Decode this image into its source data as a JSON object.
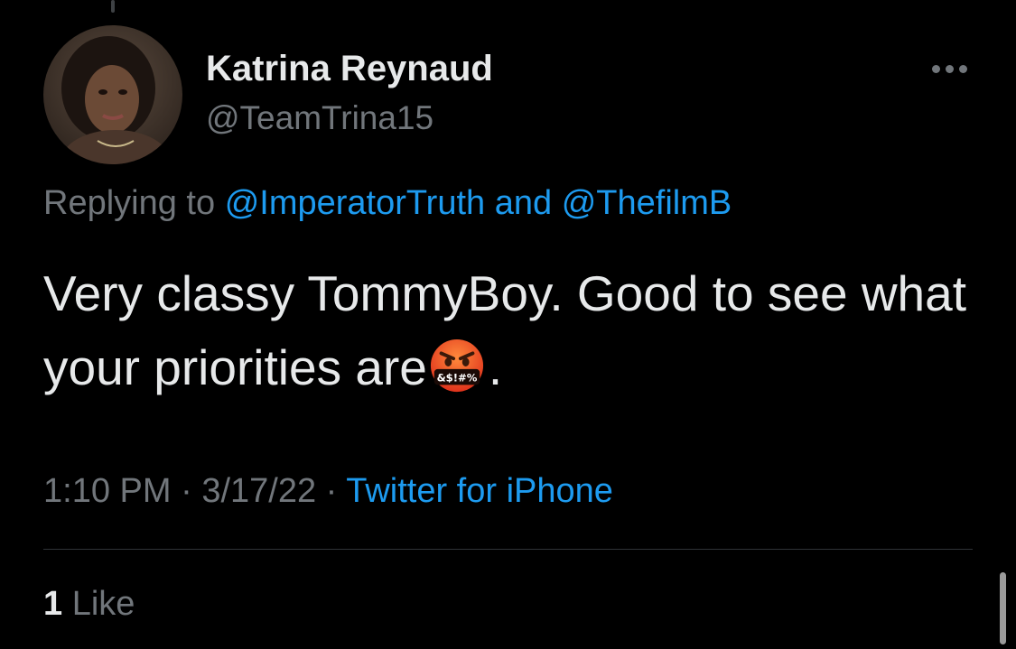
{
  "author": {
    "display_name": "Katrina Reynaud",
    "handle": "@TeamTrina15",
    "avatar_icon": "profile-photo"
  },
  "reply": {
    "prefix": "Replying to",
    "mention_1": "@ImperatorTruth",
    "conjunction": "and",
    "mention_2": "@ThefilmB"
  },
  "tweet": {
    "text_before_emoji": "Very classy TommyBoy. Good to see what your priorities are",
    "emoji_icon": "face-with-symbols-on-mouth-icon",
    "emoji_text": "&$!#%",
    "text_after_emoji": "."
  },
  "meta": {
    "time": "1:10 PM",
    "separator": "·",
    "date": "3/17/22",
    "source": "Twitter for iPhone"
  },
  "engagement": {
    "likes_count": "1",
    "likes_label": "Like"
  },
  "colors": {
    "background": "#000000",
    "text_primary": "#e7e9ea",
    "text_secondary": "#71767b",
    "accent": "#1d9bf0",
    "divider": "#2f3336"
  }
}
